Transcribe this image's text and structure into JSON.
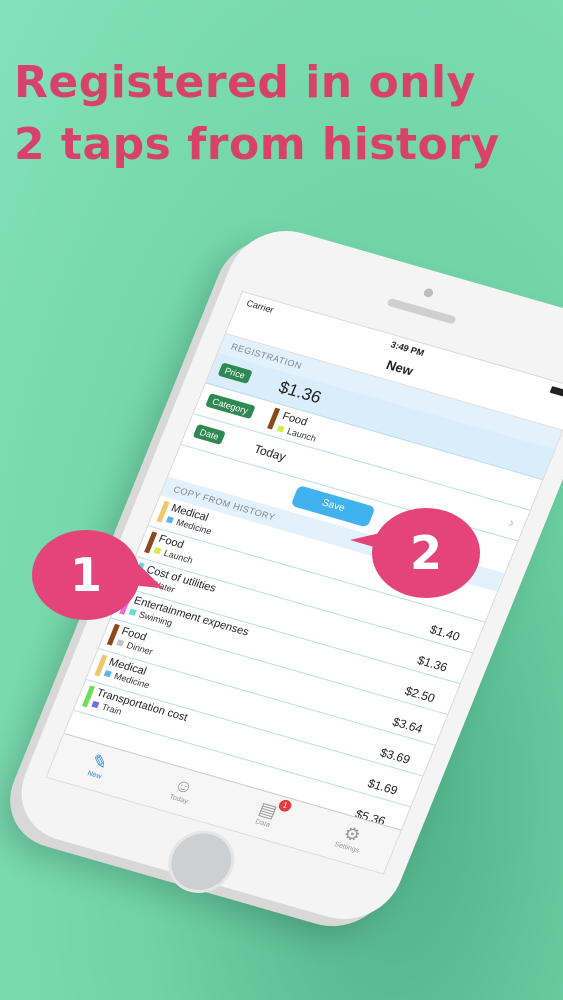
{
  "headline": {
    "line1": "Registered in only",
    "line2": "2 taps from history"
  },
  "status": {
    "carrier": "Carrier",
    "time": "3:49 PM"
  },
  "nav": {
    "title": "New"
  },
  "registration": {
    "header": "REGISTRATION",
    "price_tag": "Price",
    "price_value": "$1.36",
    "category_tag": "Category",
    "category_main": "Food",
    "category_sub": "Launch",
    "date_tag": "Date",
    "date_value": "Today",
    "save_label": "Save"
  },
  "history": {
    "header": "COPY FROM HISTORY",
    "items": [
      {
        "main": "Medical",
        "sub": "Medicine",
        "price": "",
        "color": "#f2c66a",
        "mini": "#5bb6ee"
      },
      {
        "main": "Food",
        "sub": "Launch",
        "price": "$1.40",
        "color": "#8a4a1c",
        "mini": "#d9e84a"
      },
      {
        "main": "Cost of utilities",
        "sub": "Water",
        "price": "$1.36",
        "color": "#5ee0d8",
        "mini": "#5ee0d8"
      },
      {
        "main": "Entertainment expenses",
        "sub": "Swiming",
        "price": "$2.50",
        "color": "#f06ad6",
        "mini": "#5ee0d8"
      },
      {
        "main": "Food",
        "sub": "Dinner",
        "price": "$3.64",
        "color": "#8a4a1c",
        "mini": "#c5c5c5"
      },
      {
        "main": "Medical",
        "sub": "Medicine",
        "price": "$3.69",
        "color": "#f2c66a",
        "mini": "#5bb6ee"
      },
      {
        "main": "Transportation cost",
        "sub": "Train",
        "price": "$1.69",
        "color": "#6ae05a",
        "mini": "#6a6ef0"
      },
      {
        "main": "",
        "sub": "",
        "price": "$5.36",
        "color": "#ffffff",
        "mini": "#ffffff"
      }
    ]
  },
  "tabs": [
    {
      "label": "New",
      "icon": "pencil-icon",
      "glyph": "✎"
    },
    {
      "label": "Today",
      "icon": "smiley-icon",
      "glyph": "☺"
    },
    {
      "label": "Data",
      "icon": "document-icon",
      "glyph": "▤",
      "badge": "1"
    },
    {
      "label": "Settings",
      "icon": "gear-icon",
      "glyph": "⚙"
    }
  ],
  "callouts": {
    "one": "1",
    "two": "2"
  }
}
